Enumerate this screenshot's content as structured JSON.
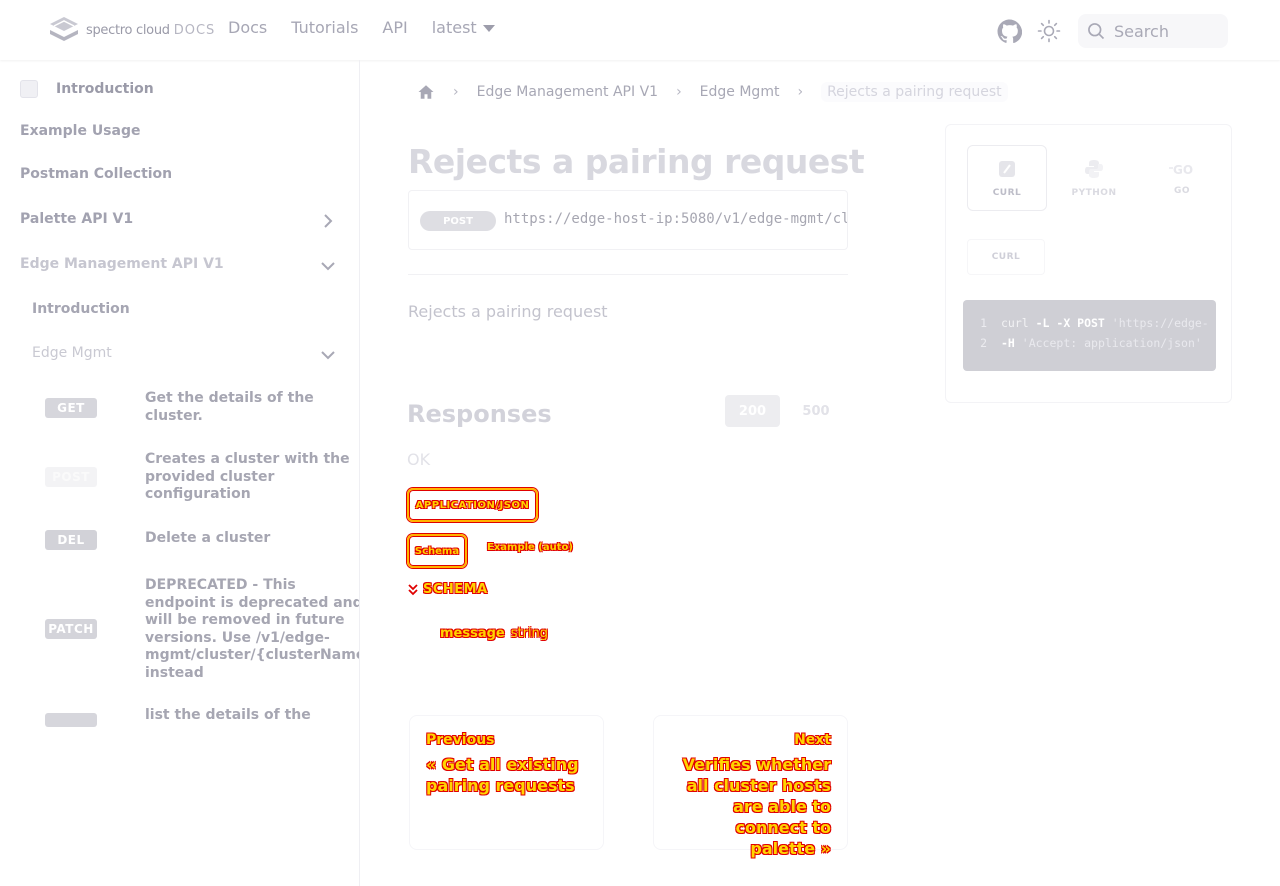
{
  "navbar": {
    "logo_text": "spectro cloud",
    "logo_suffix": "DOCS",
    "links": [
      "Docs",
      "Tutorials",
      "API"
    ],
    "version": "latest",
    "search_placeholder": "Search"
  },
  "sidebar": {
    "intro_top": "Introduction",
    "example_usage": "Example Usage",
    "postman": "Postman Collection",
    "palette_api": "Palette API V1",
    "edge_api": "Edge Management API V1",
    "edge_intro": "Introduction",
    "edge_mgmt": "Edge Mgmt",
    "operations": [
      {
        "method": "GET",
        "label": "Get the details of the cluster."
      },
      {
        "method": "POST",
        "label": "Creates a cluster with the provided cluster configuration"
      },
      {
        "method": "DEL",
        "label": "Delete a cluster"
      },
      {
        "method": "PATCH",
        "label": "DEPRECATED - This endpoint is deprecated and will be removed in future versions. Use /v1/edge-mgmt/cluster/{clusterName} instead"
      },
      {
        "method": "",
        "label": "list the details of the"
      }
    ]
  },
  "main": {
    "breadcrumb": [
      "Edge Management API V1",
      "Edge Mgmt",
      "Rejects a pairing request"
    ],
    "title": "Rejects a pairing request",
    "method": "POST",
    "url": "https://edge-host-ip:5080/v1/edge-mgmt/cl",
    "description": "Rejects a pairing request",
    "responses_title": "Responses",
    "response_codes": [
      "200",
      "500"
    ],
    "response_desc": "OK",
    "mime_type": "APPLICATION/JSON",
    "tab_schema": "Schema",
    "tab_example": "Example (auto)",
    "schema_label": "SCHEMA",
    "schema_prop_name": "message",
    "schema_prop_type": "string",
    "prev_label": "Previous",
    "prev_title": "« Get all existing pairing requests",
    "next_label": "Next",
    "next_title": "Verifies whether all cluster hosts are able to connect to palette »"
  },
  "code_panel": {
    "langs": [
      "CURL",
      "PYTHON",
      "GO"
    ],
    "sub_tab": "CURL",
    "lines": [
      {
        "n": "1",
        "pre": "curl ",
        "kw": "-L -X POST",
        "str": " 'https://edge-"
      },
      {
        "n": "2",
        "pre": "",
        "kw": "-H",
        "str": " 'Accept: application/json'"
      }
    ]
  }
}
